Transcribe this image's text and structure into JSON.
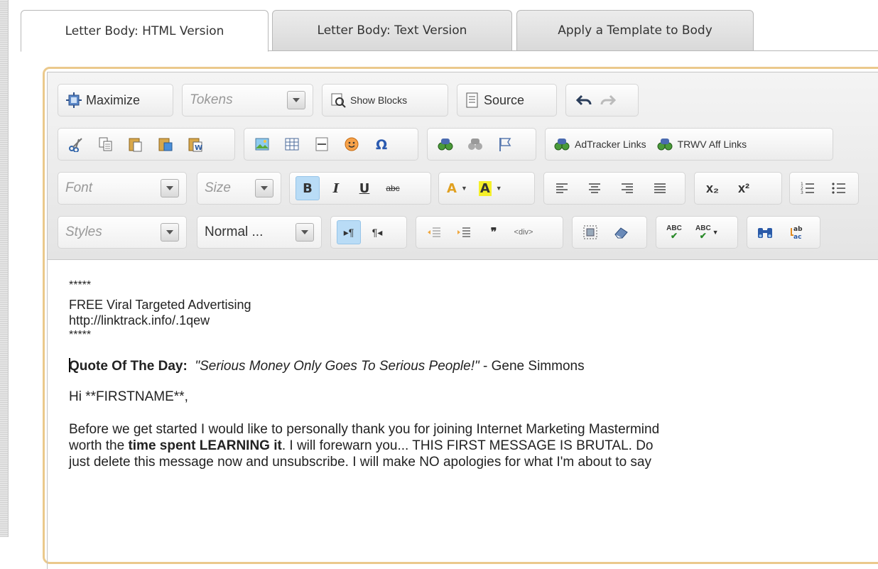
{
  "tabs": [
    {
      "label": "Letter Body: HTML Version",
      "active": true
    },
    {
      "label": "Letter Body: Text Version",
      "active": false
    },
    {
      "label": "Apply a Template to Body",
      "active": false
    }
  ],
  "toolbar": {
    "maximize_label": "Maximize",
    "tokens_placeholder": "Tokens",
    "show_blocks_label": "Show Blocks",
    "source_label": "Source",
    "adtracker_label": "AdTracker Links",
    "trwv_label": "TRWV Aff Links",
    "font_placeholder": "Font",
    "size_placeholder": "Size",
    "styles_placeholder": "Styles",
    "format_value": "Normal ...",
    "bold_label": "B",
    "italic_label": "I",
    "underline_label": "U",
    "strike_label": "abc",
    "textcolor_label": "A",
    "bgcolor_label": "A",
    "sub_label": "x₂",
    "sup_label": "x²",
    "spell_label": "ABC",
    "spell2_label": "ABC"
  },
  "content": {
    "stars1": "*****",
    "ad_line": "FREE Viral Targeted Advertising",
    "ad_url": "http://linktrack.info/.1qew",
    "stars2": "*****",
    "quote_label": "Quote Of The Day:",
    "quote_text": "\"Serious Money Only Goes To Serious People!\"",
    "quote_author": " - Gene Simmons",
    "greeting": "Hi **FIRSTNAME**,",
    "para1_a": "Before we get started I would like to personally thank you for joining Internet Marketing Mastermind",
    "para1_b_pre": "worth the ",
    "para1_b_bold": "time spent LEARNING it",
    "para1_b_post": ".  I will forewarn you... THIS FIRST MESSAGE IS BRUTAL.  Do",
    "para1_c": "just delete this message now and unsubscribe.  I will make NO apologies for what I'm about to say"
  }
}
